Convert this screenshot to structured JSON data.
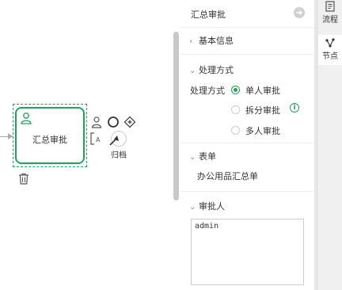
{
  "canvas": {
    "task_label": "汇总审批",
    "archive_label": "归档"
  },
  "panel": {
    "title": "汇总审批",
    "sections": {
      "basic": "基本信息",
      "method": "处理方式",
      "form": "表单",
      "approver": "审批人"
    },
    "method_label": "处理方式",
    "options": [
      "单人审批",
      "拆分审批",
      "多人审批"
    ],
    "selected_option": "单人审批",
    "form_name": "办公用品汇总单",
    "approver_value": "admin"
  },
  "rail": {
    "tabs": [
      "流程",
      "节点"
    ]
  },
  "colors": {
    "accent": "#21a35a",
    "scrollbar": "#c8c8c8",
    "rail_bg": "#f0f0f0"
  }
}
